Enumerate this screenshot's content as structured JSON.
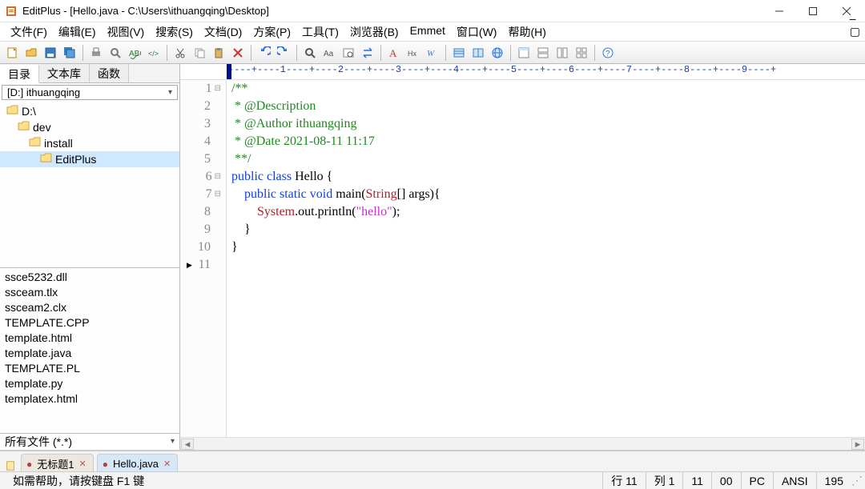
{
  "title": "EditPlus - [Hello.java - C:\\Users\\ithuangqing\\Desktop]",
  "menu": [
    "文件(F)",
    "编辑(E)",
    "视图(V)",
    "搜索(S)",
    "文档(D)",
    "方案(P)",
    "工具(T)",
    "浏览器(B)",
    "Emmet",
    "窗口(W)",
    "帮助(H)"
  ],
  "side_tabs": [
    "目录",
    "文本库",
    "函数"
  ],
  "drive_dropdown": "[D:] ithuangqing",
  "tree": [
    {
      "label": "D:\\",
      "indent": 0
    },
    {
      "label": "dev",
      "indent": 1
    },
    {
      "label": "install",
      "indent": 2
    },
    {
      "label": "EditPlus",
      "indent": 3,
      "selected": true
    }
  ],
  "files": [
    "ssce5232.dll",
    "ssceam.tlx",
    "ssceam2.clx",
    "TEMPLATE.CPP",
    "template.html",
    "template.java",
    "TEMPLATE.PL",
    "template.py",
    "templatex.html"
  ],
  "file_filter": "所有文件 (*.*)",
  "ruler": "----+----1----+----2----+----3----+----4----+----5----+----6----+----7----+----8----+----9----+",
  "code": {
    "lines": [
      {
        "n": 1,
        "fold": "⊟",
        "tokens": [
          {
            "t": "/**",
            "c": "c-comment"
          }
        ]
      },
      {
        "n": 2,
        "tokens": [
          {
            "t": " * @Description",
            "c": "c-comment"
          }
        ]
      },
      {
        "n": 3,
        "tokens": [
          {
            "t": " * @Author ithuangqing",
            "c": "c-comment"
          }
        ]
      },
      {
        "n": 4,
        "tokens": [
          {
            "t": " * @Date 2021-08-11 11:17",
            "c": "c-comment"
          }
        ]
      },
      {
        "n": 5,
        "tokens": [
          {
            "t": " **/",
            "c": "c-comment"
          }
        ]
      },
      {
        "n": 6,
        "fold": "⊟",
        "tokens": [
          {
            "t": "public class ",
            "c": "c-keyword"
          },
          {
            "t": "Hello {",
            "c": "c-ident"
          }
        ]
      },
      {
        "n": 7,
        "fold": "⊟",
        "tokens": [
          {
            "t": "    ",
            "c": ""
          },
          {
            "t": "public static void ",
            "c": "c-keyword"
          },
          {
            "t": "main(",
            "c": "c-ident"
          },
          {
            "t": "String",
            "c": "c-type"
          },
          {
            "t": "[] args){",
            "c": "c-ident"
          }
        ]
      },
      {
        "n": 8,
        "tokens": [
          {
            "t": "        ",
            "c": ""
          },
          {
            "t": "System",
            "c": "c-type"
          },
          {
            "t": ".out.println(",
            "c": "c-ident"
          },
          {
            "t": "\"hello\"",
            "c": "c-string"
          },
          {
            "t": ");",
            "c": "c-ident"
          }
        ]
      },
      {
        "n": 9,
        "tokens": [
          {
            "t": "    }",
            "c": "c-ident"
          }
        ]
      },
      {
        "n": 10,
        "tokens": [
          {
            "t": "}",
            "c": "c-ident"
          }
        ]
      },
      {
        "n": 11,
        "cursor": true,
        "tokens": [
          {
            "t": "",
            "c": ""
          }
        ]
      }
    ]
  },
  "doctabs": [
    {
      "label": "无标题1",
      "active": false,
      "dirty": true
    },
    {
      "label": "Hello.java",
      "active": true,
      "dirty": true
    }
  ],
  "status": {
    "help": "如需帮助，请按键盘 F1 键",
    "line": "行 11",
    "col": "列 1",
    "sel": "11",
    "mode": "00",
    "platform": "PC",
    "encoding": "ANSI",
    "size": "195"
  },
  "toolbar_icons": [
    "new",
    "open",
    "save",
    "saveall",
    "",
    "print",
    "preview",
    "spell",
    "htmlcheck",
    "",
    "cut",
    "copy",
    "paste",
    "delete",
    "",
    "undo",
    "redo",
    "",
    "find",
    "findre",
    "findfiles",
    "replace",
    "",
    "font",
    "hex",
    "wrap",
    "",
    "col1",
    "col2",
    "browser",
    "",
    "win1",
    "win2",
    "win3",
    "win4",
    "",
    "help"
  ]
}
